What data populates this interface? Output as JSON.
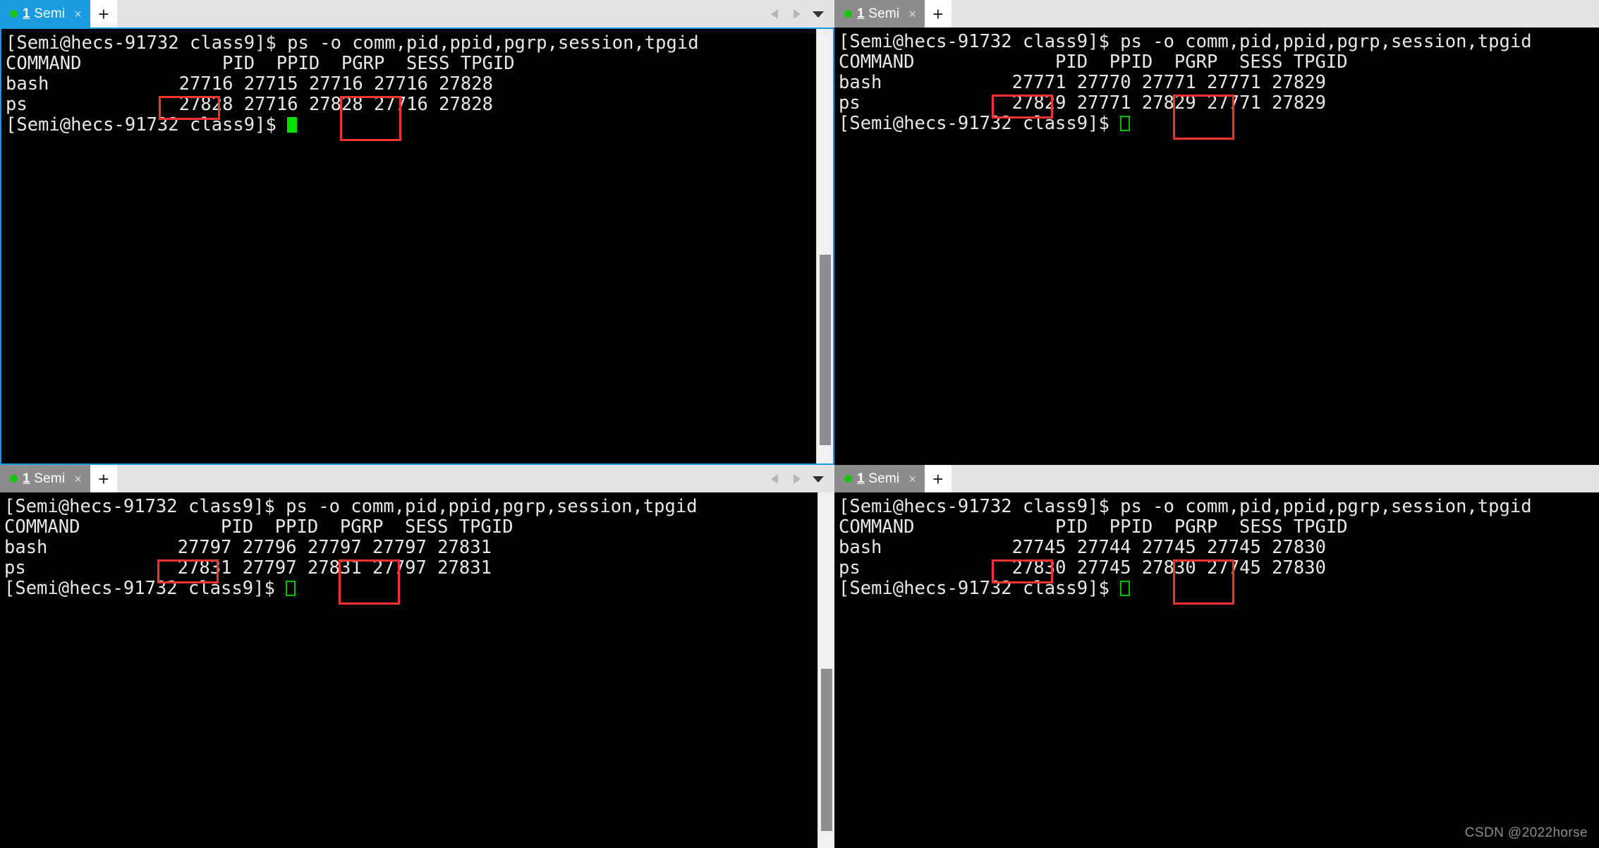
{
  "app": {
    "watermark": "CSDN @2022horse"
  },
  "tab": {
    "dot": "status-dot-green",
    "index": "1",
    "name": "Semi",
    "close_label": "×",
    "new_tab_label": "+",
    "prev_icon": "triangle-left-icon",
    "next_icon": "triangle-right-icon",
    "menu_icon": "chevron-down-icon"
  },
  "colors": {
    "active_tab": "#1a9be0",
    "inactive_tab": "#8c8c8c",
    "tabbar_bg": "#e4e4e4",
    "terminal_bg": "#000000",
    "terminal_fg": "#e8e8e8",
    "highlight_box": "#f5322c",
    "cursor": "#00e000",
    "status_dot": "#16c60c"
  },
  "terminal": {
    "prompt": "[Semi@hecs-91732 class9]$",
    "command": " ps -o comm,pid,ppid,pgrp,session,tpgid",
    "header": "COMMAND             PID  PPID  PGRP  SESS TPGID"
  },
  "panels": [
    {
      "id": "top-left",
      "active": true,
      "tab_state": "active",
      "cursor_style": "solid",
      "command_line": "[Semi@hecs-91732 class9]$ ps -o comm,pid,ppid,pgrp,session,tpgid",
      "header_line": "COMMAND             PID  PPID  PGRP  SESS TPGID",
      "rows": [
        {
          "command": "bash",
          "pid": "27716",
          "ppid": "27715",
          "pgrp": "27716",
          "sess": "27716",
          "tpgid": "27828"
        },
        {
          "command": "ps",
          "pid": "27828",
          "ppid": "27716",
          "pgrp": "27828",
          "sess": "27716",
          "tpgid": "27828"
        }
      ],
      "prompt_line": "[Semi@hecs-91732 class9]$ ",
      "highlight_pid": "27716",
      "highlight_sess": "27716",
      "scrollbar": true
    },
    {
      "id": "top-right",
      "active": false,
      "tab_state": "inactive",
      "cursor_style": "hollow",
      "command_line": "[Semi@hecs-91732 class9]$ ps -o comm,pid,ppid,pgrp,session,tpgid",
      "header_line": "COMMAND             PID  PPID  PGRP  SESS TPGID",
      "rows": [
        {
          "command": "bash",
          "pid": "27771",
          "ppid": "27770",
          "pgrp": "27771",
          "sess": "27771",
          "tpgid": "27829"
        },
        {
          "command": "ps",
          "pid": "27829",
          "ppid": "27771",
          "pgrp": "27829",
          "sess": "27771",
          "tpgid": "27829"
        }
      ],
      "prompt_line": "[Semi@hecs-91732 class9]$ ",
      "highlight_pid": "27771",
      "highlight_sess": "27771",
      "scrollbar": false
    },
    {
      "id": "bottom-left",
      "active": false,
      "tab_state": "inactive",
      "cursor_style": "hollow",
      "command_line": "[Semi@hecs-91732 class9]$ ps -o comm,pid,ppid,pgrp,session,tpgid",
      "header_line": "COMMAND             PID  PPID  PGRP  SESS TPGID",
      "rows": [
        {
          "command": "bash",
          "pid": "27797",
          "ppid": "27796",
          "pgrp": "27797",
          "sess": "27797",
          "tpgid": "27831"
        },
        {
          "command": "ps",
          "pid": "27831",
          "ppid": "27797",
          "pgrp": "27831",
          "sess": "27797",
          "tpgid": "27831"
        }
      ],
      "prompt_line": "[Semi@hecs-91732 class9]$ ",
      "highlight_pid": "27797",
      "highlight_sess": "27797",
      "scrollbar": true
    },
    {
      "id": "bottom-right",
      "active": false,
      "tab_state": "inactive",
      "cursor_style": "hollow",
      "command_line": "[Semi@hecs-91732 class9]$ ps -o comm,pid,ppid,pgrp,session,tpgid",
      "header_line": "COMMAND             PID  PPID  PGRP  SESS TPGID",
      "rows": [
        {
          "command": "bash",
          "pid": "27745",
          "ppid": "27744",
          "pgrp": "27745",
          "sess": "27745",
          "tpgid": "27830"
        },
        {
          "command": "ps",
          "pid": "27830",
          "ppid": "27745",
          "pgrp": "27830",
          "sess": "27745",
          "tpgid": "27830"
        }
      ],
      "prompt_line": "[Semi@hecs-91732 class9]$ ",
      "highlight_pid": "27745",
      "highlight_sess": "27745",
      "scrollbar": false
    }
  ]
}
